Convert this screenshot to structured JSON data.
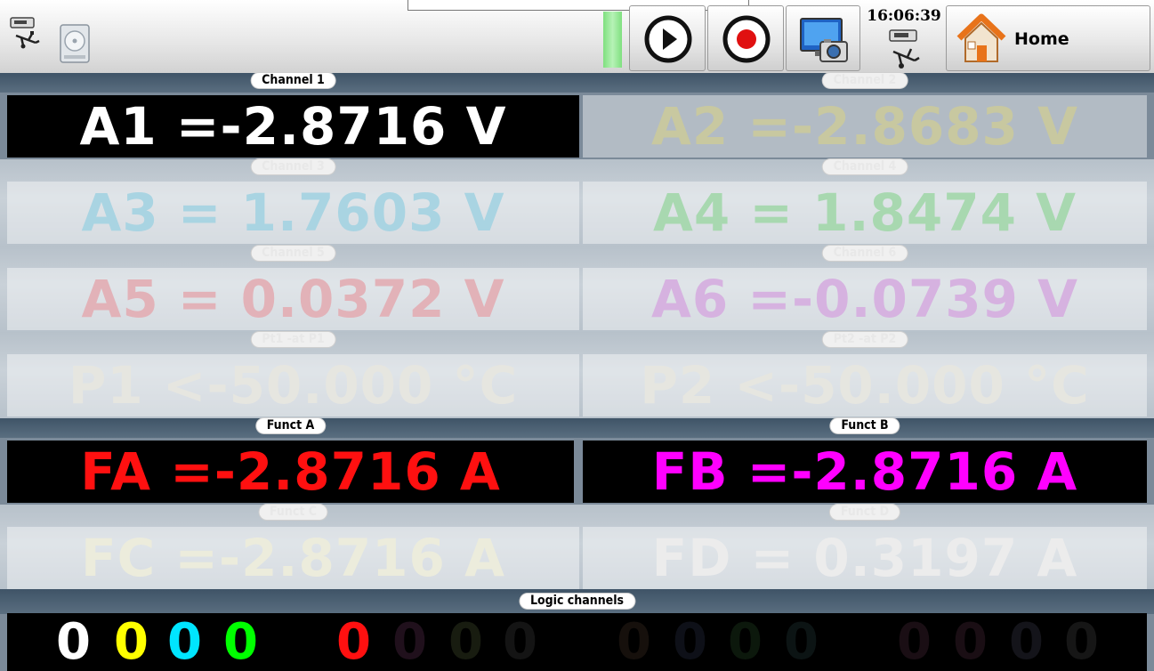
{
  "toolbar": {
    "time": "16:06:39",
    "home_label": "Home",
    "indicator_color": "#7fe07f",
    "icons": [
      "usb-icon",
      "disk-icon",
      "play-icon",
      "record-icon",
      "screenshot-icon",
      "usb-icon",
      "home-icon"
    ]
  },
  "channels": [
    {
      "label": "Channel 1",
      "value": "A1 =-2.8716 V",
      "color": "#ffffff",
      "active": true
    },
    {
      "label": "Channel 2",
      "value": "A2 =-2.8683 V",
      "color": "#c8c8a0",
      "active": false
    },
    {
      "label": "Channel 3",
      "value": "A3 = 1.7603 V",
      "color": "#a9d4e2",
      "active": false
    },
    {
      "label": "Channel 4",
      "value": "A4 = 1.8474 V",
      "color": "#a8d8b0",
      "active": false
    },
    {
      "label": "Channel 5",
      "value": "A5 = 0.0372 V",
      "color": "#e2b2b8",
      "active": false
    },
    {
      "label": "Channel 6",
      "value": "A6 =-0.0739 V",
      "color": "#d6b2e0",
      "active": false
    },
    {
      "label": "Pt1 -at P1",
      "value": "P1 <-50.000 °C",
      "color": "#e6e6e0",
      "active": false
    },
    {
      "label": "Pt2 -at P2",
      "value": "P2 <-50.000 °C",
      "color": "#e6e6e0",
      "active": false
    },
    {
      "label": "Funct  A",
      "value": "FA =-2.8716 A",
      "color": "#ff1010",
      "active": true
    },
    {
      "label": "Funct  B",
      "value": "FB =-2.8716 A",
      "color": "#ff00ff",
      "active": true
    },
    {
      "label": "Funct  C",
      "value": "FC =-2.8716 A",
      "color": "#ececdc",
      "active": false
    },
    {
      "label": "Funct  D",
      "value": "FD = 0.3197 A",
      "color": "#ececec",
      "active": false
    }
  ],
  "logic": {
    "label": "Logic channels",
    "digits": [
      {
        "value": "0",
        "color": "#ffffff"
      },
      {
        "value": "0",
        "color": "#ffff00"
      },
      {
        "value": "0",
        "color": "#00e5ff"
      },
      {
        "value": "0",
        "color": "#00ff00"
      },
      {
        "value": "0",
        "color": "#ff1010"
      },
      {
        "value": "0",
        "color": "#20101c"
      },
      {
        "value": "0",
        "color": "#181c10"
      },
      {
        "value": "0",
        "color": "#141414"
      },
      {
        "value": "0",
        "color": "#16100c"
      },
      {
        "value": "0",
        "color": "#0e1018"
      },
      {
        "value": "0",
        "color": "#0c180c"
      },
      {
        "value": "0",
        "color": "#0c1414"
      },
      {
        "value": "0",
        "color": "#1a0e14"
      },
      {
        "value": "0",
        "color": "#1a0e14"
      },
      {
        "value": "0",
        "color": "#14141a"
      },
      {
        "value": "0",
        "color": "#161616"
      }
    ]
  }
}
